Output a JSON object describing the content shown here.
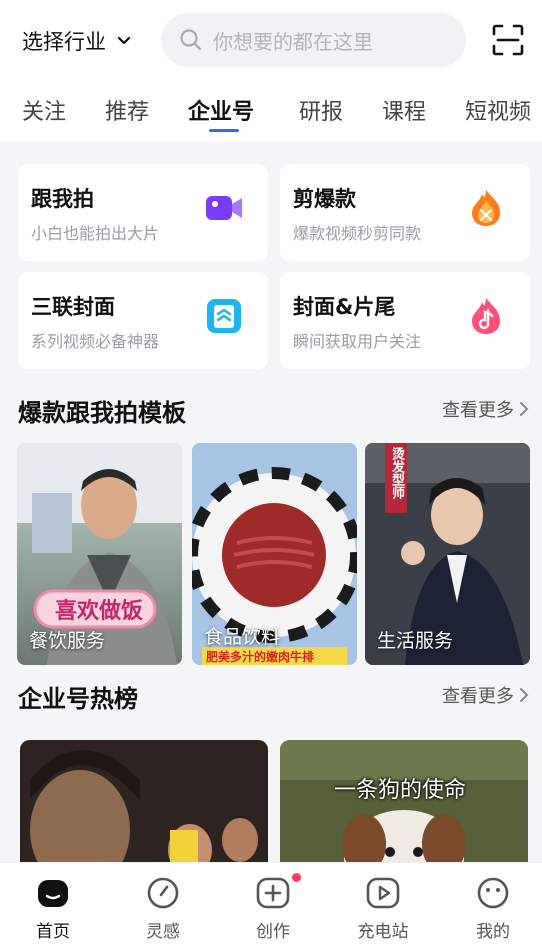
{
  "header": {
    "industry_label": "选择行业",
    "search_placeholder": "你想要的都在这里"
  },
  "tabs": [
    {
      "label": "关注"
    },
    {
      "label": "推荐"
    },
    {
      "label": "企业号",
      "active": true
    },
    {
      "label": "研报"
    },
    {
      "label": "课程"
    },
    {
      "label": "短视频"
    }
  ],
  "tools": [
    {
      "title": "跟我拍",
      "subtitle": "小白也能拍出大片",
      "icon": "video-camera-icon",
      "color": "#7b3cf5"
    },
    {
      "title": "剪爆款",
      "subtitle": "爆款视频秒剪同款",
      "icon": "flame-scissors-icon",
      "color": "#ff7a1a"
    },
    {
      "title": "三联封面",
      "subtitle": "系列视频必备神器",
      "icon": "cover-frame-icon",
      "color": "#1fb4f0"
    },
    {
      "title": "封面&片尾",
      "subtitle": "瞬间获取用户关注",
      "icon": "music-flame-icon",
      "color": "#ff4f7b"
    }
  ],
  "templates_section": {
    "title": "爆款跟我拍模板",
    "more": "查看更多",
    "items": [
      {
        "label": "餐饮服务",
        "overlay_text": "喜欢做饭"
      },
      {
        "label": "食品饮料",
        "overlay_text": "肥美多汁的嫩肉牛排"
      },
      {
        "label": "生活服务",
        "overlay_text": "烫发型师"
      }
    ]
  },
  "hot_section": {
    "title": "企业号热榜",
    "more": "查看更多",
    "items": [
      {
        "caption": ""
      },
      {
        "caption": "一条狗的使命"
      }
    ]
  },
  "bottom_nav": [
    {
      "label": "首页",
      "icon": "home-icon",
      "active": true
    },
    {
      "label": "灵感",
      "icon": "compass-icon"
    },
    {
      "label": "创作",
      "icon": "create-plus-icon",
      "badge": true
    },
    {
      "label": "充电站",
      "icon": "play-icon"
    },
    {
      "label": "我的",
      "icon": "profile-icon"
    }
  ],
  "colors": {
    "accent": "#2a6cf6",
    "badge": "#ff3b5c"
  }
}
